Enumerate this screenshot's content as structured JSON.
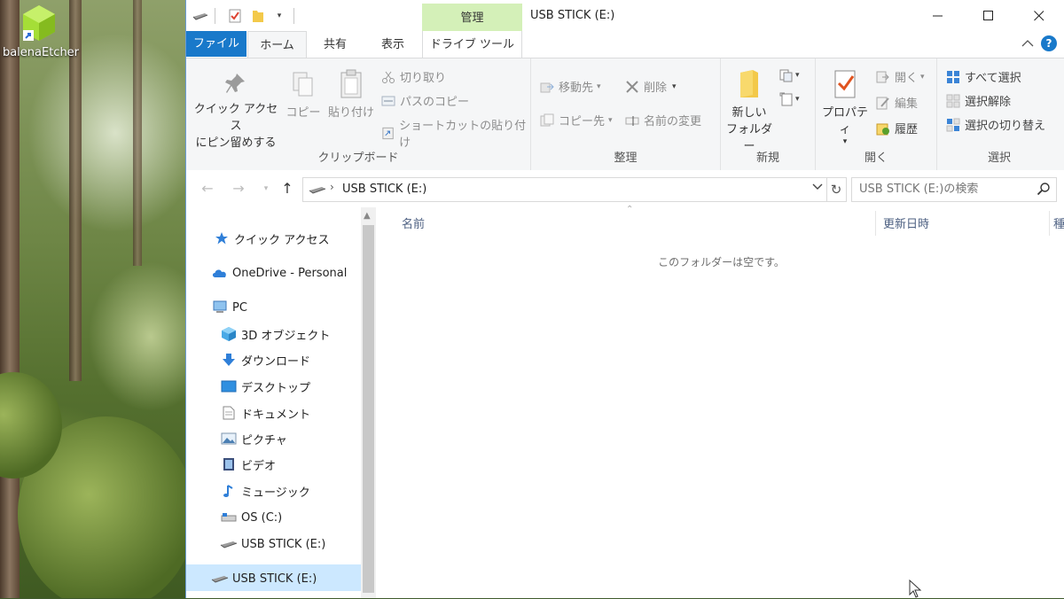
{
  "desktop": {
    "icon_label": "balenaEtcher"
  },
  "window": {
    "title": "USB STICK (E:)",
    "contextual_tab_group": "管理",
    "controls": {
      "minimize": "—",
      "maximize": "☐",
      "close": "✕"
    }
  },
  "tabs": {
    "file": "ファイル",
    "home": "ホーム",
    "share": "共有",
    "view": "表示",
    "drive_tools": "ドライブ ツール",
    "help": "?"
  },
  "ribbon": {
    "clipboard": {
      "label": "クリップボード",
      "pin_line1": "クイック アクセス",
      "pin_line2": "にピン留めする",
      "copy": "コピー",
      "paste": "貼り付け",
      "cut": "切り取り",
      "copy_path": "パスのコピー",
      "paste_shortcut": "ショートカットの貼り付け"
    },
    "organize": {
      "label": "整理",
      "move_to": "移動先",
      "copy_to": "コピー先",
      "delete": "削除",
      "rename": "名前の変更"
    },
    "new": {
      "label": "新規",
      "new_folder_line1": "新しい",
      "new_folder_line2": "フォルダー"
    },
    "open": {
      "label": "開く",
      "properties": "プロパティ",
      "open": "開く",
      "edit": "編集",
      "history": "履歴"
    },
    "select": {
      "label": "選択",
      "select_all": "すべて選択",
      "select_none": "選択解除",
      "invert_selection": "選択の切り替え"
    }
  },
  "address": {
    "path": "USB STICK (E:)",
    "search_placeholder": "USB STICK (E:)の検索"
  },
  "nav": {
    "items": [
      {
        "label": "クイック アクセス",
        "icon": "star-icon"
      },
      {
        "label": "OneDrive - Personal",
        "icon": "cloud-icon"
      },
      {
        "label": "PC",
        "icon": "pc-icon"
      },
      {
        "label": "3D オブジェクト",
        "icon": "cube-icon"
      },
      {
        "label": "ダウンロード",
        "icon": "download-icon"
      },
      {
        "label": "デスクトップ",
        "icon": "desktop-icon"
      },
      {
        "label": "ドキュメント",
        "icon": "document-icon"
      },
      {
        "label": "ピクチャ",
        "icon": "picture-icon"
      },
      {
        "label": "ビデオ",
        "icon": "video-icon"
      },
      {
        "label": "ミュージック",
        "icon": "music-icon"
      },
      {
        "label": "OS (C:)",
        "icon": "drive-icon"
      },
      {
        "label": "USB STICK (E:)",
        "icon": "usb-drive-icon"
      },
      {
        "label": "USB STICK (E:)",
        "icon": "usb-drive-icon"
      }
    ]
  },
  "content": {
    "columns": {
      "name": "名前",
      "modified": "更新日時",
      "type": "種"
    },
    "empty_message": "このフォルダーは空です。"
  },
  "colors": {
    "file_tab": "#1979ca",
    "manage_tab": "#d4f0b8",
    "selection": "#cce8ff"
  }
}
